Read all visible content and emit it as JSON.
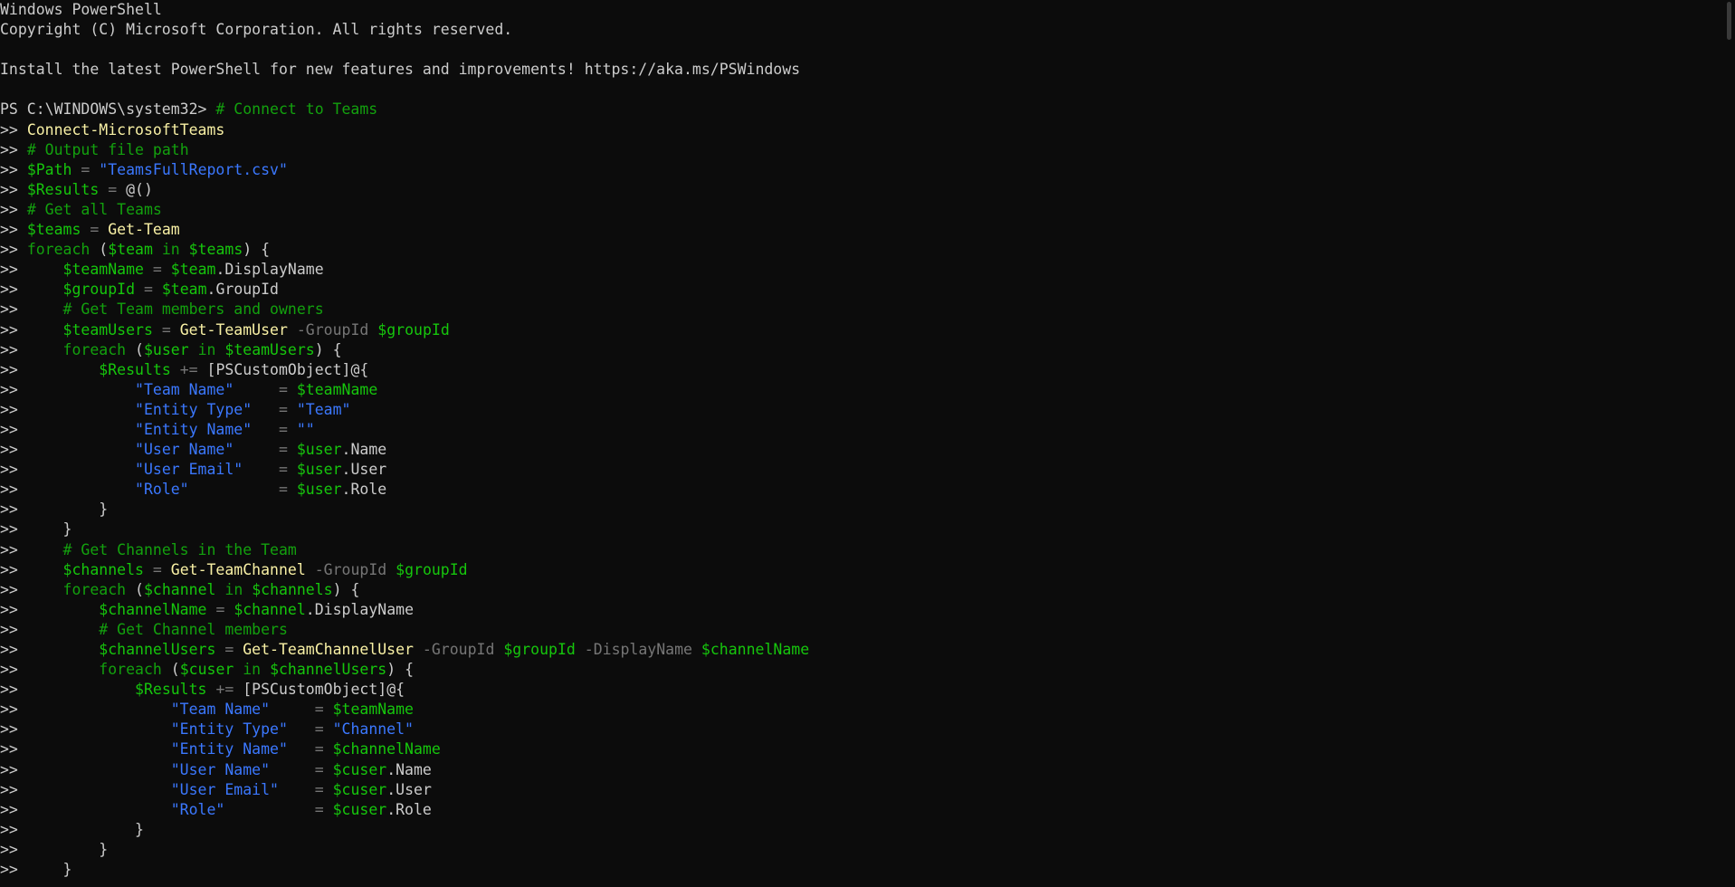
{
  "window": {
    "title": "Windows PowerShell"
  },
  "colors": {
    "background": "#0c0c0c",
    "default_text": "#cccccc",
    "comment": "#13a10e",
    "command": "#f9f1a5",
    "variable": "#16c60c",
    "keyword": "#13a10e",
    "string": "#3b78ff",
    "operator_param": "#767676"
  },
  "console": {
    "lines": [
      [
        [
          "default",
          "Windows PowerShell"
        ]
      ],
      [
        [
          "default",
          "Copyright (C) Microsoft Corporation. All rights reserved."
        ]
      ],
      [
        [
          "default",
          ""
        ]
      ],
      [
        [
          "default",
          "Install the latest PowerShell for new features and improvements! https://aka.ms/PSWindows"
        ]
      ],
      [
        [
          "default",
          ""
        ]
      ],
      [
        [
          "default",
          "PS C:\\WINDOWS\\system32> "
        ],
        [
          "comment",
          "# Connect to Teams"
        ]
      ],
      [
        [
          "default",
          ">> "
        ],
        [
          "command",
          "Connect-MicrosoftTeams"
        ]
      ],
      [
        [
          "default",
          ">> "
        ],
        [
          "comment",
          "# Output file path"
        ]
      ],
      [
        [
          "default",
          ">> "
        ],
        [
          "variable",
          "$Path"
        ],
        [
          "default",
          " "
        ],
        [
          "operator",
          "="
        ],
        [
          "default",
          " "
        ],
        [
          "string",
          "\"TeamsFullReport.csv\""
        ]
      ],
      [
        [
          "default",
          ">> "
        ],
        [
          "variable",
          "$Results"
        ],
        [
          "default",
          " "
        ],
        [
          "operator",
          "="
        ],
        [
          "default",
          " @()"
        ]
      ],
      [
        [
          "default",
          ">> "
        ],
        [
          "comment",
          "# Get all Teams"
        ]
      ],
      [
        [
          "default",
          ">> "
        ],
        [
          "variable",
          "$teams"
        ],
        [
          "default",
          " "
        ],
        [
          "operator",
          "="
        ],
        [
          "default",
          " "
        ],
        [
          "command",
          "Get-Team"
        ]
      ],
      [
        [
          "default",
          ">> "
        ],
        [
          "keyword",
          "foreach"
        ],
        [
          "default",
          " ("
        ],
        [
          "variable",
          "$team"
        ],
        [
          "default",
          " "
        ],
        [
          "keyword",
          "in"
        ],
        [
          "default",
          " "
        ],
        [
          "variable",
          "$teams"
        ],
        [
          "default",
          ") {"
        ]
      ],
      [
        [
          "default",
          ">>     "
        ],
        [
          "variable",
          "$teamName"
        ],
        [
          "default",
          " "
        ],
        [
          "operator",
          "="
        ],
        [
          "default",
          " "
        ],
        [
          "variable",
          "$team"
        ],
        [
          "default",
          ".DisplayName"
        ]
      ],
      [
        [
          "default",
          ">>     "
        ],
        [
          "variable",
          "$groupId"
        ],
        [
          "default",
          " "
        ],
        [
          "operator",
          "="
        ],
        [
          "default",
          " "
        ],
        [
          "variable",
          "$team"
        ],
        [
          "default",
          ".GroupId"
        ]
      ],
      [
        [
          "default",
          ">>     "
        ],
        [
          "comment",
          "# Get Team members and owners"
        ]
      ],
      [
        [
          "default",
          ">>     "
        ],
        [
          "variable",
          "$teamUsers"
        ],
        [
          "default",
          " "
        ],
        [
          "operator",
          "="
        ],
        [
          "default",
          " "
        ],
        [
          "command",
          "Get-TeamUser"
        ],
        [
          "default",
          " "
        ],
        [
          "param",
          "-GroupId"
        ],
        [
          "default",
          " "
        ],
        [
          "variable",
          "$groupId"
        ]
      ],
      [
        [
          "default",
          ">>     "
        ],
        [
          "keyword",
          "foreach"
        ],
        [
          "default",
          " ("
        ],
        [
          "variable",
          "$user"
        ],
        [
          "default",
          " "
        ],
        [
          "keyword",
          "in"
        ],
        [
          "default",
          " "
        ],
        [
          "variable",
          "$teamUsers"
        ],
        [
          "default",
          ") {"
        ]
      ],
      [
        [
          "default",
          ">>         "
        ],
        [
          "variable",
          "$Results"
        ],
        [
          "default",
          " "
        ],
        [
          "operator",
          "+="
        ],
        [
          "default",
          " [PSCustomObject]@{"
        ]
      ],
      [
        [
          "default",
          ">>             "
        ],
        [
          "string",
          "\"Team Name\""
        ],
        [
          "default",
          "     "
        ],
        [
          "operator",
          "="
        ],
        [
          "default",
          " "
        ],
        [
          "variable",
          "$teamName"
        ]
      ],
      [
        [
          "default",
          ">>             "
        ],
        [
          "string",
          "\"Entity Type\""
        ],
        [
          "default",
          "   "
        ],
        [
          "operator",
          "="
        ],
        [
          "default",
          " "
        ],
        [
          "string",
          "\"Team\""
        ]
      ],
      [
        [
          "default",
          ">>             "
        ],
        [
          "string",
          "\"Entity Name\""
        ],
        [
          "default",
          "   "
        ],
        [
          "operator",
          "="
        ],
        [
          "default",
          " "
        ],
        [
          "string",
          "\"\""
        ]
      ],
      [
        [
          "default",
          ">>             "
        ],
        [
          "string",
          "\"User Name\""
        ],
        [
          "default",
          "     "
        ],
        [
          "operator",
          "="
        ],
        [
          "default",
          " "
        ],
        [
          "variable",
          "$user"
        ],
        [
          "default",
          ".Name"
        ]
      ],
      [
        [
          "default",
          ">>             "
        ],
        [
          "string",
          "\"User Email\""
        ],
        [
          "default",
          "    "
        ],
        [
          "operator",
          "="
        ],
        [
          "default",
          " "
        ],
        [
          "variable",
          "$user"
        ],
        [
          "default",
          ".User"
        ]
      ],
      [
        [
          "default",
          ">>             "
        ],
        [
          "string",
          "\"Role\""
        ],
        [
          "default",
          "          "
        ],
        [
          "operator",
          "="
        ],
        [
          "default",
          " "
        ],
        [
          "variable",
          "$user"
        ],
        [
          "default",
          ".Role"
        ]
      ],
      [
        [
          "default",
          ">>         }"
        ]
      ],
      [
        [
          "default",
          ">>     }"
        ]
      ],
      [
        [
          "default",
          ">>     "
        ],
        [
          "comment",
          "# Get Channels in the Team"
        ]
      ],
      [
        [
          "default",
          ">>     "
        ],
        [
          "variable",
          "$channels"
        ],
        [
          "default",
          " "
        ],
        [
          "operator",
          "="
        ],
        [
          "default",
          " "
        ],
        [
          "command",
          "Get-TeamChannel"
        ],
        [
          "default",
          " "
        ],
        [
          "param",
          "-GroupId"
        ],
        [
          "default",
          " "
        ],
        [
          "variable",
          "$groupId"
        ]
      ],
      [
        [
          "default",
          ">>     "
        ],
        [
          "keyword",
          "foreach"
        ],
        [
          "default",
          " ("
        ],
        [
          "variable",
          "$channel"
        ],
        [
          "default",
          " "
        ],
        [
          "keyword",
          "in"
        ],
        [
          "default",
          " "
        ],
        [
          "variable",
          "$channels"
        ],
        [
          "default",
          ") {"
        ]
      ],
      [
        [
          "default",
          ">>         "
        ],
        [
          "variable",
          "$channelName"
        ],
        [
          "default",
          " "
        ],
        [
          "operator",
          "="
        ],
        [
          "default",
          " "
        ],
        [
          "variable",
          "$channel"
        ],
        [
          "default",
          ".DisplayName"
        ]
      ],
      [
        [
          "default",
          ">>         "
        ],
        [
          "comment",
          "# Get Channel members"
        ]
      ],
      [
        [
          "default",
          ">>         "
        ],
        [
          "variable",
          "$channelUsers"
        ],
        [
          "default",
          " "
        ],
        [
          "operator",
          "="
        ],
        [
          "default",
          " "
        ],
        [
          "command",
          "Get-TeamChannelUser"
        ],
        [
          "default",
          " "
        ],
        [
          "param",
          "-GroupId"
        ],
        [
          "default",
          " "
        ],
        [
          "variable",
          "$groupId"
        ],
        [
          "default",
          " "
        ],
        [
          "param",
          "-DisplayName"
        ],
        [
          "default",
          " "
        ],
        [
          "variable",
          "$channelName"
        ]
      ],
      [
        [
          "default",
          ">>         "
        ],
        [
          "keyword",
          "foreach"
        ],
        [
          "default",
          " ("
        ],
        [
          "variable",
          "$cuser"
        ],
        [
          "default",
          " "
        ],
        [
          "keyword",
          "in"
        ],
        [
          "default",
          " "
        ],
        [
          "variable",
          "$channelUsers"
        ],
        [
          "default",
          ") {"
        ]
      ],
      [
        [
          "default",
          ">>             "
        ],
        [
          "variable",
          "$Results"
        ],
        [
          "default",
          " "
        ],
        [
          "operator",
          "+="
        ],
        [
          "default",
          " [PSCustomObject]@{"
        ]
      ],
      [
        [
          "default",
          ">>                 "
        ],
        [
          "string",
          "\"Team Name\""
        ],
        [
          "default",
          "     "
        ],
        [
          "operator",
          "="
        ],
        [
          "default",
          " "
        ],
        [
          "variable",
          "$teamName"
        ]
      ],
      [
        [
          "default",
          ">>                 "
        ],
        [
          "string",
          "\"Entity Type\""
        ],
        [
          "default",
          "   "
        ],
        [
          "operator",
          "="
        ],
        [
          "default",
          " "
        ],
        [
          "string",
          "\"Channel\""
        ]
      ],
      [
        [
          "default",
          ">>                 "
        ],
        [
          "string",
          "\"Entity Name\""
        ],
        [
          "default",
          "   "
        ],
        [
          "operator",
          "="
        ],
        [
          "default",
          " "
        ],
        [
          "variable",
          "$channelName"
        ]
      ],
      [
        [
          "default",
          ">>                 "
        ],
        [
          "string",
          "\"User Name\""
        ],
        [
          "default",
          "     "
        ],
        [
          "operator",
          "="
        ],
        [
          "default",
          " "
        ],
        [
          "variable",
          "$cuser"
        ],
        [
          "default",
          ".Name"
        ]
      ],
      [
        [
          "default",
          ">>                 "
        ],
        [
          "string",
          "\"User Email\""
        ],
        [
          "default",
          "    "
        ],
        [
          "operator",
          "="
        ],
        [
          "default",
          " "
        ],
        [
          "variable",
          "$cuser"
        ],
        [
          "default",
          ".User"
        ]
      ],
      [
        [
          "default",
          ">>                 "
        ],
        [
          "string",
          "\"Role\""
        ],
        [
          "default",
          "          "
        ],
        [
          "operator",
          "="
        ],
        [
          "default",
          " "
        ],
        [
          "variable",
          "$cuser"
        ],
        [
          "default",
          ".Role"
        ]
      ],
      [
        [
          "default",
          ">>             }"
        ]
      ],
      [
        [
          "default",
          ">>         }"
        ]
      ],
      [
        [
          "default",
          ">>     }"
        ]
      ]
    ]
  }
}
